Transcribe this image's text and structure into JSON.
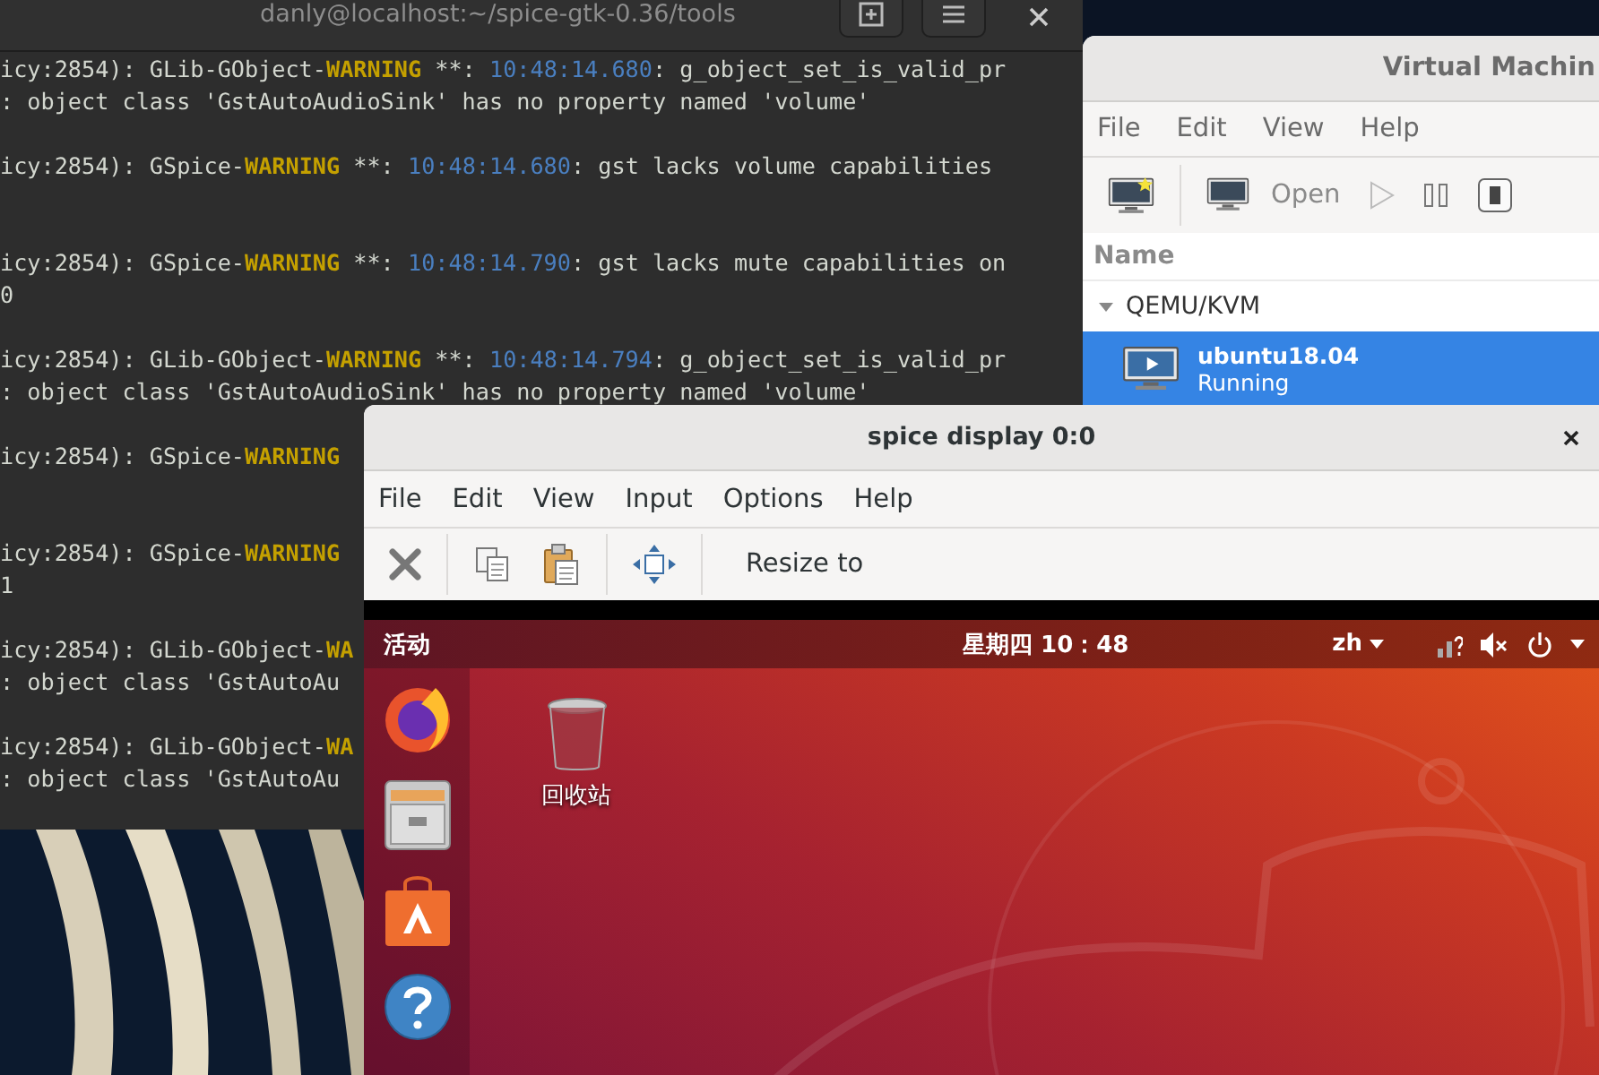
{
  "terminal": {
    "title": "danly@localhost:~/spice-gtk-0.36/tools",
    "rows": [
      {
        "kind": "log",
        "source": "icy:2854): GLib-GObject-",
        "severity": "WARNING",
        "sep": " **: ",
        "time": "10:48:14.680",
        "message": ": g_object_set_is_valid_pr"
      },
      {
        "kind": "plain",
        "text": ": object class 'GstAutoAudioSink' has no property named 'volume'"
      },
      {
        "kind": "blank"
      },
      {
        "kind": "log",
        "source": "icy:2854): GSpice-",
        "severity": "WARNING",
        "sep": " **: ",
        "time": "10:48:14.680",
        "message": ": gst lacks volume capabilities"
      },
      {
        "kind": "blank"
      },
      {
        "kind": "blank"
      },
      {
        "kind": "log",
        "source": "icy:2854): GSpice-",
        "severity": "WARNING",
        "sep": " **: ",
        "time": "10:48:14.790",
        "message": ": gst lacks mute capabilities on"
      },
      {
        "kind": "plain",
        "text": "0"
      },
      {
        "kind": "blank"
      },
      {
        "kind": "log",
        "source": "icy:2854): GLib-GObject-",
        "severity": "WARNING",
        "sep": " **: ",
        "time": "10:48:14.794",
        "message": ": g_object_set_is_valid_pr"
      },
      {
        "kind": "plain",
        "text": ": object class 'GstAutoAudioSink' has no property named 'volume'"
      },
      {
        "kind": "blank"
      },
      {
        "kind": "log",
        "source": "icy:2854): GSpice-",
        "severity": "WARNING"
      },
      {
        "kind": "blank"
      },
      {
        "kind": "blank"
      },
      {
        "kind": "log",
        "source": "icy:2854): GSpice-",
        "severity": "WARNING"
      },
      {
        "kind": "plain",
        "text": "1"
      },
      {
        "kind": "blank"
      },
      {
        "kind": "log",
        "source": "icy:2854): GLib-GObject-",
        "severity": "WA"
      },
      {
        "kind": "plain",
        "text": ": object class 'GstAutoAu"
      },
      {
        "kind": "blank"
      },
      {
        "kind": "log",
        "source": "icy:2854): GLib-GObject-",
        "severity": "WA"
      },
      {
        "kind": "plain",
        "text": ": object class 'GstAutoAu"
      }
    ]
  },
  "virt_manager": {
    "title": "Virtual Machin",
    "menu": [
      "File",
      "Edit",
      "View",
      "Help"
    ],
    "toolbar": {
      "open_label": "Open"
    },
    "column": "Name",
    "groups": [
      {
        "name": "QEMU/KVM",
        "expanded": true,
        "children": [
          {
            "name": "ubuntu18.04",
            "status": "Running",
            "selected": true
          }
        ]
      }
    ]
  },
  "spice": {
    "title": "spice display 0:0",
    "menu": [
      "File",
      "Edit",
      "View",
      "Input",
      "Options",
      "Help"
    ],
    "toolbar": {
      "resize_label": "Resize to"
    },
    "guest": {
      "activities": "活动",
      "clock": "星期四 10：48",
      "input_method": "zh",
      "desktop_icons": [
        {
          "label": "回收站"
        }
      ]
    }
  }
}
